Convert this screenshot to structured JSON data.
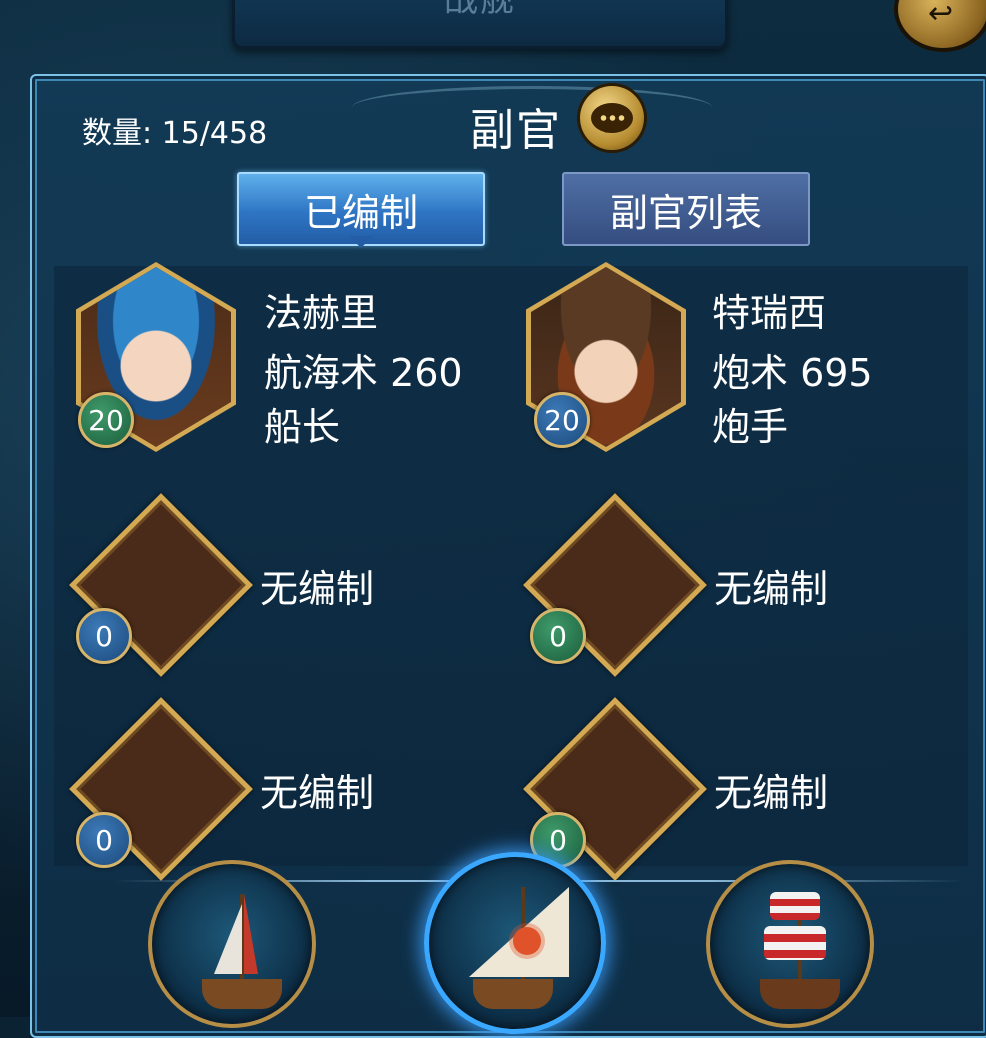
{
  "header": {
    "banner_title": "战舰"
  },
  "panel": {
    "count_text": "数量: 15/458",
    "title": "副官",
    "chat_icon": "chat-bubble-icon"
  },
  "tabs": [
    {
      "label": "已编制",
      "active": true
    },
    {
      "label": "副官列表",
      "active": false
    }
  ],
  "officers": [
    {
      "name": "法赫里",
      "skill": "航海术 260",
      "role": "船长",
      "level": "20"
    },
    {
      "name": "特瑞西",
      "skill": "炮术 695",
      "role": "炮手",
      "level": "20"
    }
  ],
  "empty_slots": [
    {
      "label": "无编制",
      "level": "0",
      "badge_color": "#1b4a7c"
    },
    {
      "label": "无编制",
      "level": "0",
      "badge_color": "#1b5e3c"
    },
    {
      "label": "无编制",
      "level": "0",
      "badge_color": "#1b4a7c"
    },
    {
      "label": "无编制",
      "level": "0",
      "badge_color": "#1b5e3c"
    }
  ],
  "ships": [
    {
      "icon": "caravel-ship-icon",
      "selected": false
    },
    {
      "icon": "sun-sail-ship-icon",
      "selected": true
    },
    {
      "icon": "galleon-ship-icon",
      "selected": false
    }
  ],
  "colors": {
    "gold": "#d3a954",
    "tab_active": "#2e75c4",
    "tab_inactive": "#354d80",
    "panel_border": "#7bc2e8"
  }
}
